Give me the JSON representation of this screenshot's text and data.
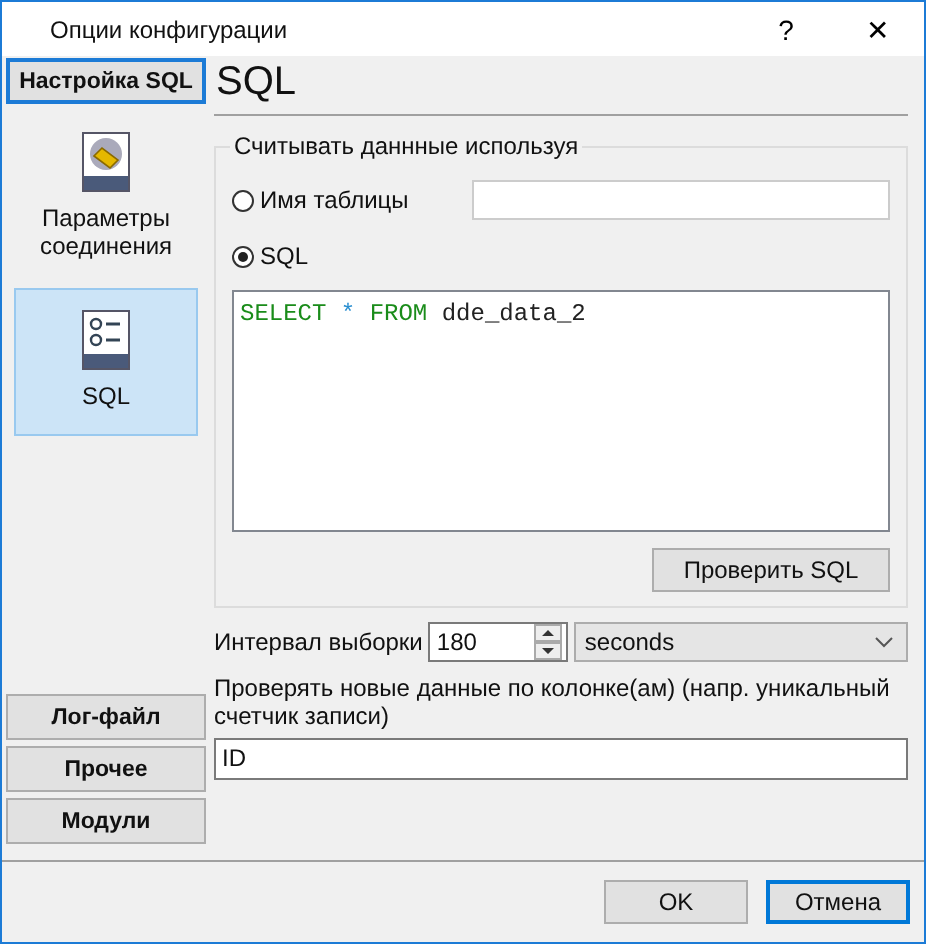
{
  "window": {
    "title": "Опции конфигурации",
    "help": "?",
    "close": "✕"
  },
  "sidebar": {
    "top_sections": [
      {
        "label": "Настройка SQL",
        "selected": true
      }
    ],
    "items": [
      {
        "label": "Параметры соединения",
        "kind": "connection",
        "selected": false
      },
      {
        "label": "SQL",
        "kind": "list",
        "selected": true
      }
    ],
    "bottom_sections": [
      {
        "label": "Лог-файл",
        "selected": false
      },
      {
        "label": "Прочее",
        "selected": false
      },
      {
        "label": "Модули",
        "selected": false
      }
    ]
  },
  "page_title": "SQL",
  "source_group": {
    "title": "Считывать даннные используя",
    "options": [
      {
        "label": "Имя таблицы",
        "selected": false
      },
      {
        "label": "SQL",
        "selected": true
      }
    ],
    "query": [
      {
        "text": "SELECT",
        "kind": "keyword"
      },
      {
        "text": "*",
        "kind": "operator"
      },
      {
        "text": "FROM",
        "kind": "keyword"
      },
      {
        "text": "dde_data_2",
        "kind": "identifier"
      }
    ],
    "check_button": "Проверить SQL"
  },
  "interval": {
    "label": "Интервал выборки",
    "value": "180",
    "unit": "seconds"
  },
  "new_data": {
    "label": "Проверять новые данные по колонке(ам) (напр. уникальный счетчик записи)",
    "value": "ID"
  },
  "buttons": [
    {
      "label": "OK",
      "focused": false
    },
    {
      "label": "Отмена",
      "focused": true
    }
  ]
}
